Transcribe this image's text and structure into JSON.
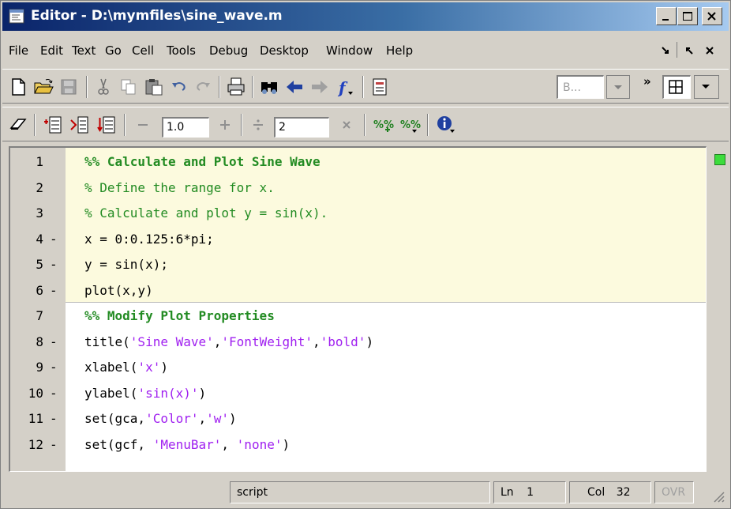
{
  "window": {
    "title": "Editor - D:\\mymfiles\\sine_wave.m",
    "buttons": [
      "minimize-icon",
      "maximize-icon",
      "close-icon"
    ]
  },
  "menu": {
    "items": [
      "File",
      "Edit",
      "Text",
      "Go",
      "Cell",
      "Tools",
      "Debug",
      "Desktop",
      "Window",
      "Help"
    ],
    "controls": [
      "dock-icon",
      "undock-icon",
      "close-icon"
    ]
  },
  "toolbar1": {
    "icons": [
      "new-file-icon",
      "open-folder-icon",
      "save-icon",
      "cut-icon",
      "copy-icon",
      "paste-icon",
      "undo-icon",
      "redo-icon",
      "print-icon",
      "find-icon",
      "back-icon",
      "forward-icon",
      "function-icon",
      "stack-icon",
      "layout-icon"
    ],
    "stack_combo": "B...",
    "more": "»"
  },
  "toolbar2": {
    "icons": [
      "eraser-icon",
      "insert-cell-above-icon",
      "insert-cell-icon",
      "insert-cell-below-icon",
      "decrement-icon",
      "increment-icon",
      "divide-icon",
      "multiply-icon",
      "comment-icon",
      "uncomment-icon",
      "info-icon"
    ],
    "increment_value": "1.0",
    "divide_value": "2"
  },
  "editor": {
    "lines": [
      {
        "num": "1",
        "dash": "",
        "type": "cellhdr",
        "text": "%% Calculate and Plot Sine Wave"
      },
      {
        "num": "2",
        "dash": "",
        "type": "cmt",
        "text": "% Define the range for x."
      },
      {
        "num": "3",
        "dash": "",
        "type": "cmt",
        "text": "% Calculate and plot y = sin(x)."
      },
      {
        "num": "4",
        "dash": "-",
        "type": "plain",
        "text": "x = 0:0.125:6*pi;"
      },
      {
        "num": "5",
        "dash": "-",
        "type": "plain",
        "text": "y = sin(x);"
      },
      {
        "num": "6",
        "dash": "-",
        "type": "plain",
        "text": "plot(x,y)"
      },
      {
        "num": "7",
        "dash": "",
        "type": "cellhdr",
        "text": "%% Modify Plot Properties"
      },
      {
        "num": "8",
        "dash": "-",
        "type": "mixed",
        "parts": [
          [
            "plain",
            "title("
          ],
          [
            "str",
            "'Sine Wave'"
          ],
          [
            "plain",
            ","
          ],
          [
            "str",
            "'FontWeight'"
          ],
          [
            "plain",
            ","
          ],
          [
            "str",
            "'bold'"
          ],
          [
            "plain",
            ")"
          ]
        ]
      },
      {
        "num": "9",
        "dash": "-",
        "type": "mixed",
        "parts": [
          [
            "plain",
            "xlabel("
          ],
          [
            "str",
            "'x'"
          ],
          [
            "plain",
            ")"
          ]
        ]
      },
      {
        "num": "10",
        "dash": "-",
        "type": "mixed",
        "parts": [
          [
            "plain",
            "ylabel("
          ],
          [
            "str",
            "'sin(x)'"
          ],
          [
            "plain",
            ")"
          ]
        ]
      },
      {
        "num": "11",
        "dash": "-",
        "type": "mixed",
        "parts": [
          [
            "plain",
            "set(gca,"
          ],
          [
            "str",
            "'Color'"
          ],
          [
            "plain",
            ","
          ],
          [
            "str",
            "'w'"
          ],
          [
            "plain",
            ")"
          ]
        ]
      },
      {
        "num": "12",
        "dash": "-",
        "type": "mixed",
        "parts": [
          [
            "plain",
            "set(gcf, "
          ],
          [
            "str",
            "'MenuBar'"
          ],
          [
            "plain",
            ", "
          ],
          [
            "str",
            "'none'"
          ],
          [
            "plain",
            ")"
          ]
        ]
      }
    ]
  },
  "status": {
    "mode": "script",
    "ln_label": "Ln",
    "ln_value": "1",
    "col_label": "Col",
    "col_value": "32",
    "ovr": "OVR"
  },
  "colors": {
    "comment": "#228b22",
    "string": "#a020f0",
    "cell_background": "#fcfade",
    "titlebar_start": "#0a246a"
  }
}
